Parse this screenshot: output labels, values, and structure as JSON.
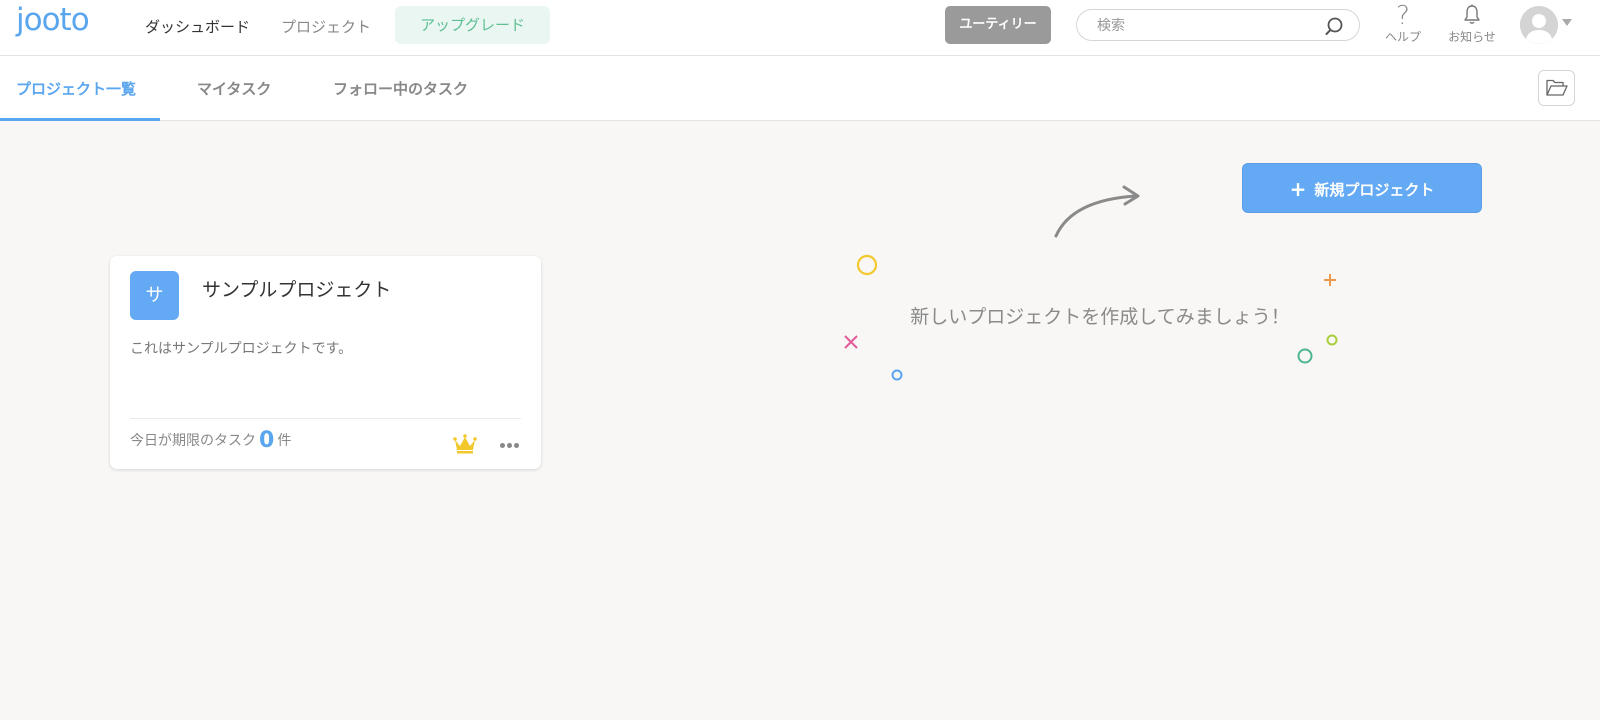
{
  "header": {
    "logo": "jooto",
    "nav": {
      "dashboard": "ダッシュボード",
      "project": "プロジェクト",
      "upgrade": "アップグレード"
    },
    "user_tier": "ユーティリー",
    "search": {
      "placeholder": "検索",
      "value": ""
    },
    "help_label": "ヘルプ",
    "notify_label": "お知らせ"
  },
  "tabs": {
    "projects": "プロジェクト一覧",
    "mytasks": "マイタスク",
    "follow": "フォロー中のタスク"
  },
  "main": {
    "new_project_label": "新規プロジェクト",
    "empty_message": "新しいプロジェクトを作成してみましょう！"
  },
  "card": {
    "badge": "サ",
    "title": "サンプルプロジェクト",
    "description": "これはサンプルプロジェクトです。",
    "due_label": "今日が期限のタスク",
    "due_count": "0",
    "due_unit": "件"
  },
  "colors": {
    "accent": "#5aa6ee",
    "upgrade_text": "#5fbf92",
    "upgrade_bg": "#eaf6f1",
    "crown": "#f2c82c"
  }
}
